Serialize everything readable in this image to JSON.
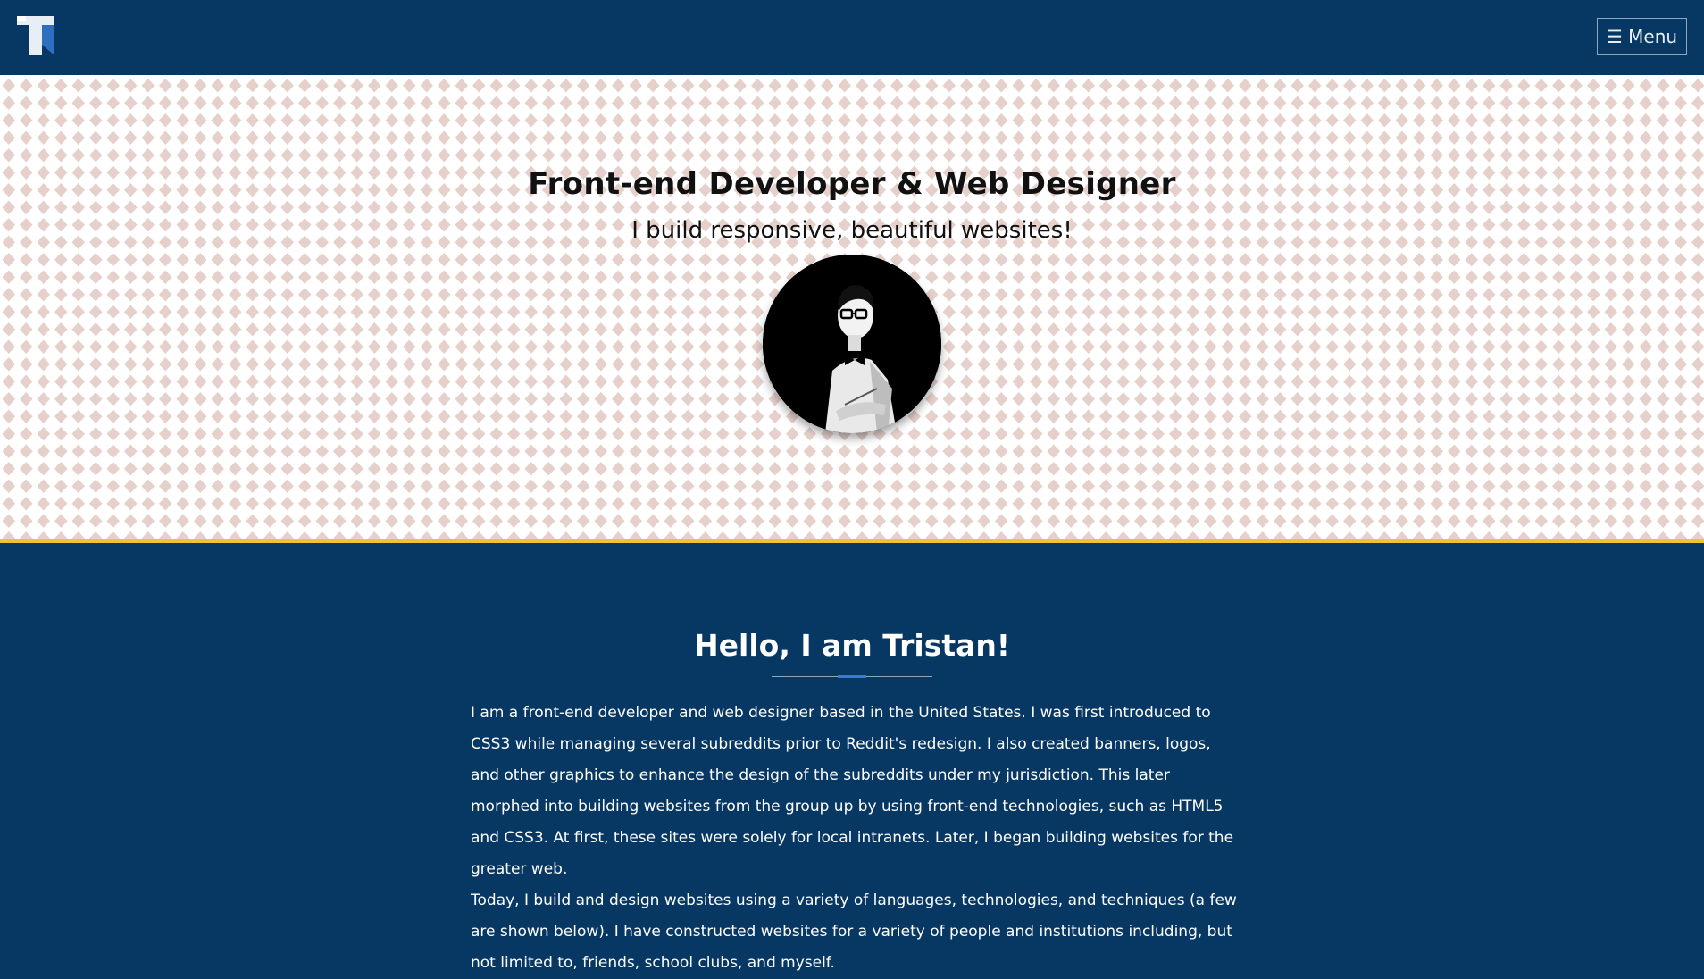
{
  "header": {
    "logo_letter": "T",
    "menu_label": "☰ Menu"
  },
  "hero": {
    "title": "Front-end Developer & Web Designer",
    "subtitle": "I build responsive, beautiful websites!"
  },
  "about": {
    "heading": "Hello, I am Tristan!",
    "paragraphs": [
      "I am a front-end developer and web designer based in the United States. I was first introduced to CSS3 while managing several subreddits prior to Reddit's redesign. I also created banners, logos, and other graphics to enhance the design of the subreddits under my jurisdiction. This later morphed into building websites from the group up by using front-end technologies, such as HTML5 and CSS3. At first, these sites were solely for local intranets. Later, I began building websites for the greater web.",
      "Today, I build and design websites using a variety of languages, technologies, and techniques (a few are shown below). I have constructed websites for a variety of people and institutions including, but not limited to, friends, school clubs, and myself."
    ]
  },
  "colors": {
    "navy": "#073763",
    "accent_yellow": "#f1c232",
    "accent_blue": "#3c78d8",
    "pattern_diamond": "#e6d0cb"
  }
}
